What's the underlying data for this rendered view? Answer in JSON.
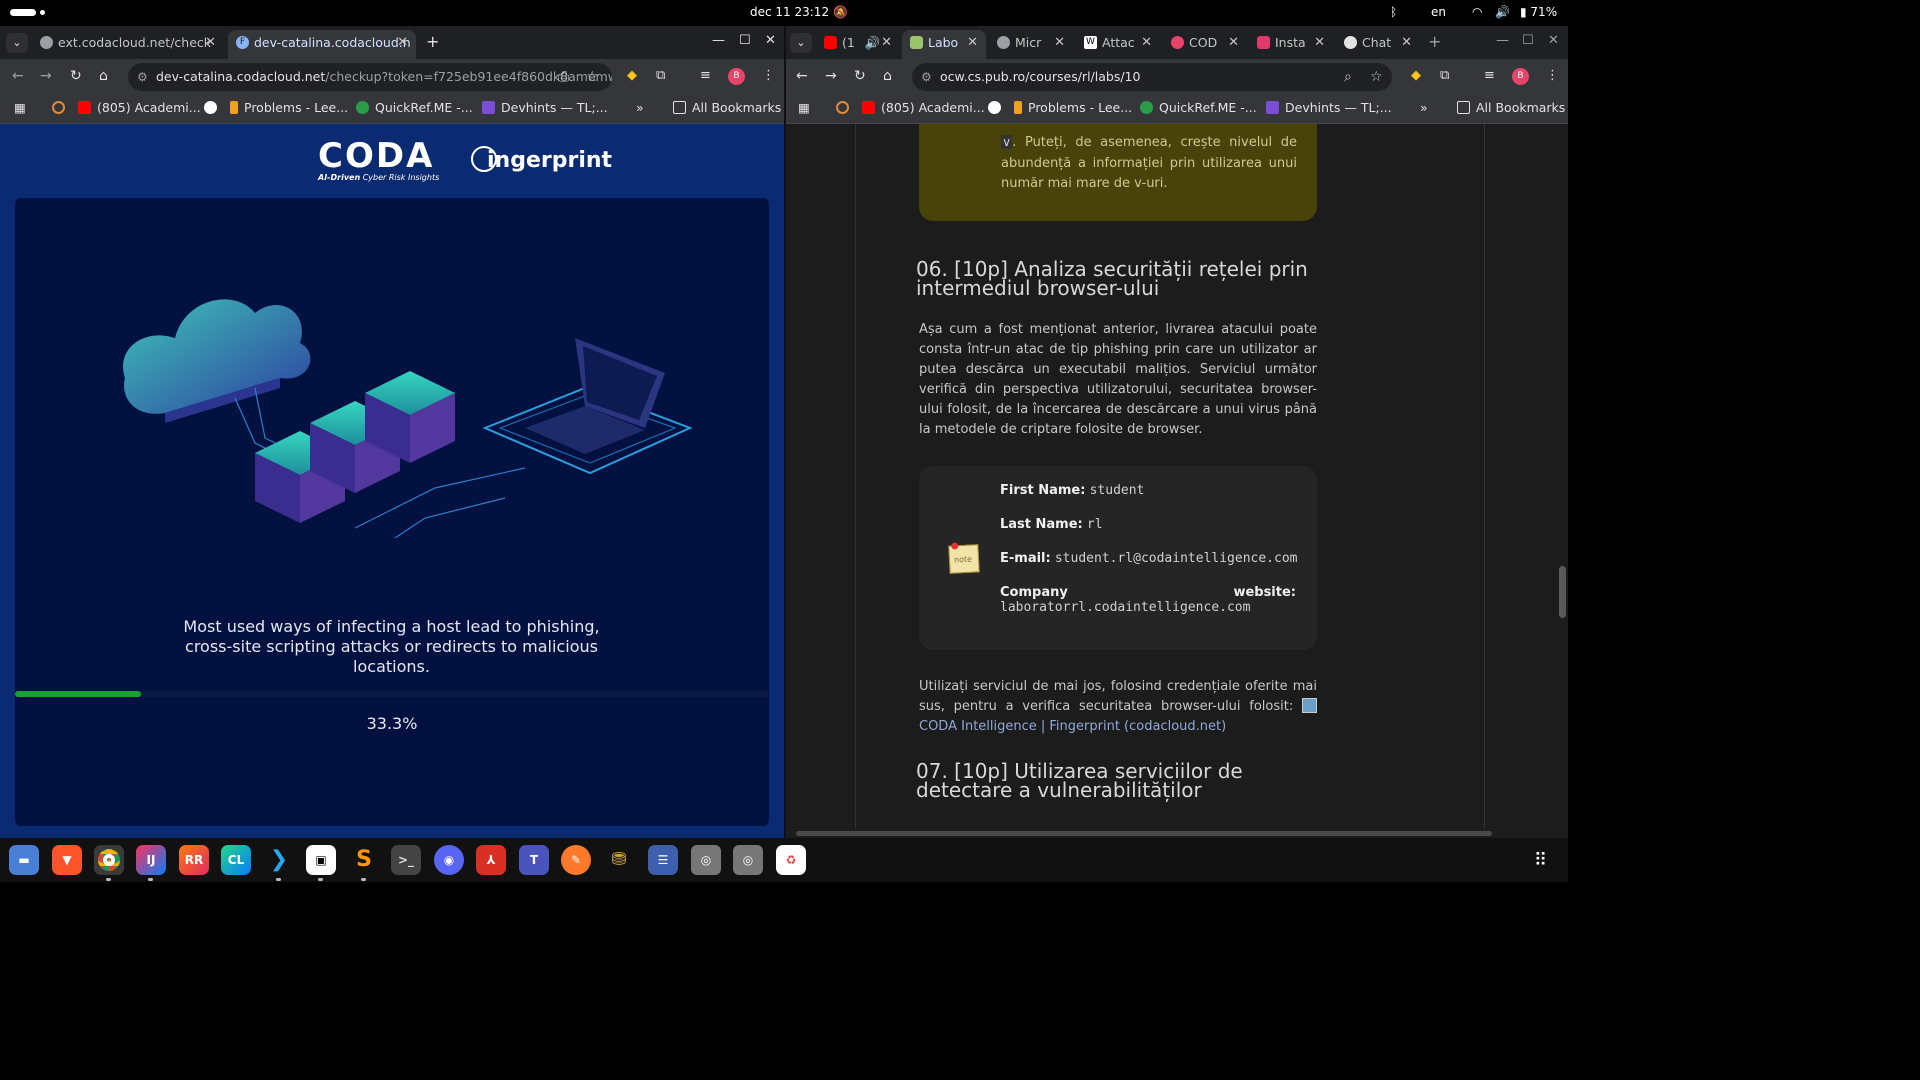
{
  "system": {
    "clock": "dec 11  23:12",
    "language": "en",
    "battery": "71%",
    "bell_icon": "notifications-off-icon",
    "bluetooth_icon": "bluetooth-icon",
    "wifi_icon": "wifi-icon",
    "volume_icon": "volume-icon",
    "battery_icon": "battery-icon"
  },
  "left_browser": {
    "tabs": [
      {
        "title": "ext.codacloud.net/check",
        "active": false
      },
      {
        "title": "dev-catalina.codacloud.n",
        "active": true
      }
    ],
    "url_host": "dev-catalina.codacloud.net",
    "url_path": "/checkup?token=f725eb91ee4f860dk8amemws...",
    "bookmarks": [
      "(805) Academi...",
      "Problems - Lee...",
      "QuickRef.ME -...",
      "Devhints — TL;..."
    ],
    "overflow": "»",
    "all_bookmarks": "All Bookmarks",
    "profile_initial": "B",
    "page": {
      "logo_text": "CODA",
      "logo_tagline_bold": "AI-Driven",
      "logo_tagline": " Cyber Risk Insights",
      "partner_logo": "ingerprint",
      "caption": "Most used ways of infecting a host lead to phishing, cross-site scripting attacks or redirects to malicious locations.",
      "progress_value": 0.333,
      "progress_label": "33.3%",
      "colors": {
        "background": "#0a2a72",
        "card": "#021140",
        "progress": "#18a232"
      }
    }
  },
  "right_browser": {
    "tabs": [
      {
        "title": "(1",
        "active": false
      },
      {
        "title": "Labo",
        "active": true
      },
      {
        "title": "Micr",
        "active": false
      },
      {
        "title": "Attac",
        "active": false
      },
      {
        "title": "COD",
        "active": false
      },
      {
        "title": "Insta",
        "active": false
      },
      {
        "title": "Chat",
        "active": false
      }
    ],
    "url": "ocw.cs.pub.ro/courses/rl/labs/10",
    "bookmarks": [
      "(805) Academi...",
      "Problems - Lee...",
      "QuickRef.ME -...",
      "Devhints — TL;..."
    ],
    "overflow": "»",
    "all_bookmarks": "All Bookmarks",
    "profile_initial": "B",
    "page": {
      "tip_text_before": "",
      "tip_code": "v",
      "tip_text": ". Puteți, de asemenea, crește nivelul de abundență a informației prin utilizarea unui număr mai mare de v-uri.",
      "section6_title": "06. [10p] Analiza securității rețelei prin intermediul browser-ului",
      "section6_para": "Așa cum a fost menționat anterior, livrarea atacului poate consta într-un atac de tip phishing prin care un utilizator ar putea descărca un executabil malițios. Serviciul următor verifică din perspectiva utilizatorului, securitatea browser-ului folosit, de la încercarea de descărcare a unui virus până la metodele de criptare folosite de browser.",
      "note": {
        "icon_label": "note",
        "first_name_label": "First Name:",
        "first_name": "student",
        "last_name_label": "Last Name:",
        "last_name": "rl",
        "email_label": "E-mail:",
        "email": "student.rl@codaintelligence.com",
        "company_label": "Company",
        "website_label": "website:",
        "website": "laboratorrl.codaintelligence.com"
      },
      "use_para": "Utilizați serviciul de mai jos, folosind credențiale oferite mai sus, pentru a verifica securitatea browser-ului folosit:",
      "use_link": "CODA Intelligence | Fingerprint (codacloud.net)",
      "section7_title": "07. [10p] Utilizarea serviciilor de detectare a vulnerabilităților"
    }
  },
  "taskbar": {
    "apps": [
      "files-icon",
      "brave-icon",
      "chrome-icon",
      "intellij-icon",
      "rustrover-icon",
      "clion-icon",
      "vscode-icon",
      "notion-icon",
      "sublime-icon",
      "terminal-icon",
      "discord-icon",
      "pdf-icon",
      "teams-icon",
      "pen-icon",
      "network-icon",
      "settings-icon",
      "disk-icon",
      "disk2-icon",
      "trash-icon"
    ],
    "labels": {
      "intellij": "IJ",
      "rustrover": "RR",
      "clion": "CL",
      "teams": "T"
    }
  }
}
